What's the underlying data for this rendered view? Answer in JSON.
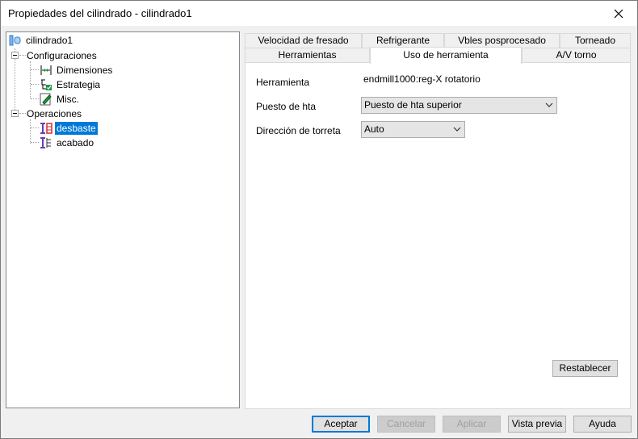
{
  "window": {
    "title": "Propiedades del cilindrado - cilindrado1"
  },
  "tree": {
    "root": "cilindrado1",
    "configuraciones": "Configuraciones",
    "dimensiones": "Dimensiones",
    "estrategia": "Estrategia",
    "misc": "Misc.",
    "operaciones": "Operaciones",
    "desbaste": "desbaste",
    "acabado": "acabado"
  },
  "tabs": {
    "row1": [
      "Velocidad de fresado",
      "Refrigerante",
      "Vbles posprocesado",
      "Torneado"
    ],
    "row2": [
      "Herramientas",
      "Uso de herramienta",
      "A/V torno"
    ],
    "active": "Uso de herramienta"
  },
  "panel": {
    "herramienta_label": "Herramienta",
    "herramienta_value": "endmill1000:reg-X rotatorio",
    "puesto_label": "Puesto de hta",
    "puesto_value": "Puesto de hta superior",
    "direccion_label": "Dirección de torreta",
    "direccion_value": "Auto",
    "reset_label": "Restablecer"
  },
  "buttons": {
    "aceptar": "Aceptar",
    "cancelar": "Cancelar",
    "aplicar": "Aplicar",
    "vista_previa": "Vista previa",
    "ayuda": "Ayuda"
  },
  "colors": {
    "selection": "#0078d7",
    "accent": "#0078d7"
  }
}
